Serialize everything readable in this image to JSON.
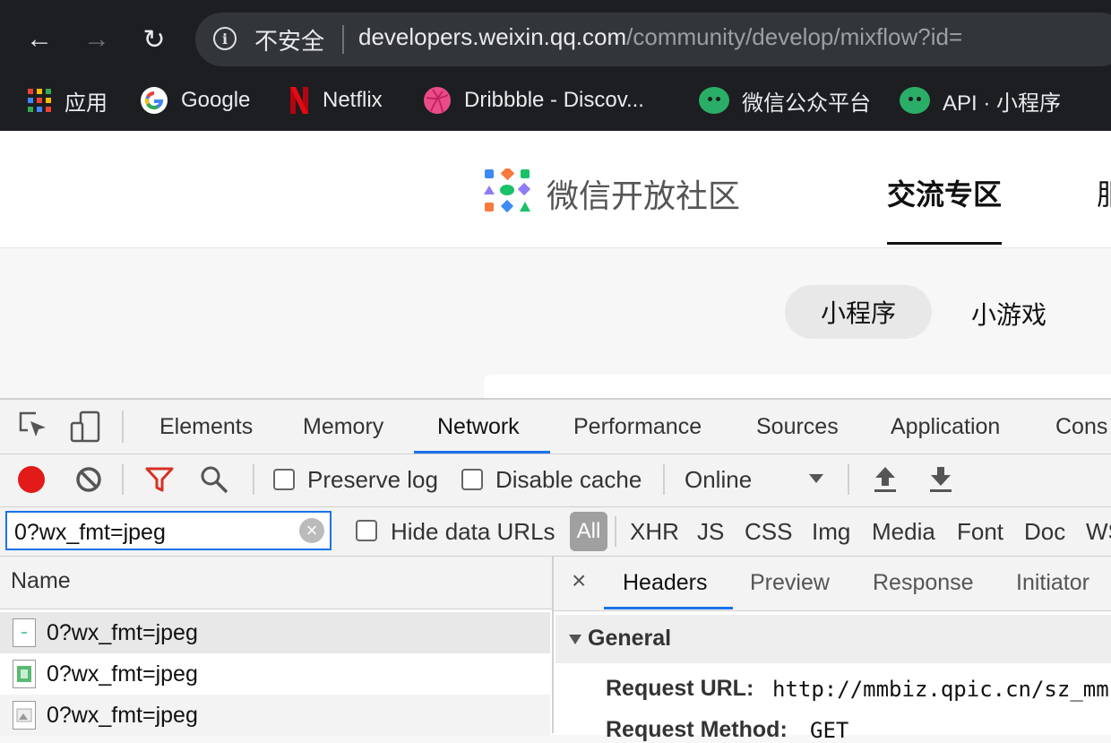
{
  "browser": {
    "nav": {
      "back": "←",
      "forward": "→",
      "reload": "↻"
    },
    "omnibox": {
      "security_label": "不安全",
      "url_host": "developers.weixin.qq.com",
      "url_path": "/community/develop/mixflow?id="
    },
    "bookmarks": [
      {
        "label": "应用",
        "icon": "apps-grid-icon"
      },
      {
        "label": "Google",
        "icon": "google-icon"
      },
      {
        "label": "Netflix",
        "icon": "netflix-icon"
      },
      {
        "label": "Dribbble - Discov...",
        "icon": "dribbble-icon"
      },
      {
        "label": "微信公众平台",
        "icon": "wechat-icon"
      },
      {
        "label": "API · 小程序",
        "icon": "wechat-icon"
      }
    ]
  },
  "site": {
    "logo_text": "微信开放社区",
    "nav_active": "交流专区",
    "nav_next": "服",
    "pills": {
      "active": "小程序",
      "other": "小游戏"
    }
  },
  "devtools": {
    "tabs": [
      "Elements",
      "Memory",
      "Network",
      "Performance",
      "Sources",
      "Application",
      "Cons"
    ],
    "active_tab": "Network",
    "controls": {
      "preserve_log": "Preserve log",
      "disable_cache": "Disable cache",
      "throttle": "Online"
    },
    "filter": {
      "value": "0?wx_fmt=jpeg",
      "clear": "×",
      "hide_data_urls": "Hide data URLs",
      "types": [
        "All",
        "XHR",
        "JS",
        "CSS",
        "Img",
        "Media",
        "Font",
        "Doc",
        "WS"
      ]
    },
    "list": {
      "header": "Name",
      "rows": [
        "0?wx_fmt=jpeg",
        "0?wx_fmt=jpeg",
        "0?wx_fmt=jpeg"
      ]
    },
    "detail": {
      "close": "×",
      "tabs": [
        "Headers",
        "Preview",
        "Response",
        "Initiator"
      ],
      "section": "General",
      "request_url_key": "Request URL:",
      "request_url_value": "http://mmbiz.qpic.cn/sz_mm",
      "request_method_key": "Request Method:",
      "request_method_value": "GET"
    }
  },
  "colors": {
    "accent": "#1a73e8",
    "record": "#e21a1a",
    "filter_funnel": "#d93025"
  }
}
